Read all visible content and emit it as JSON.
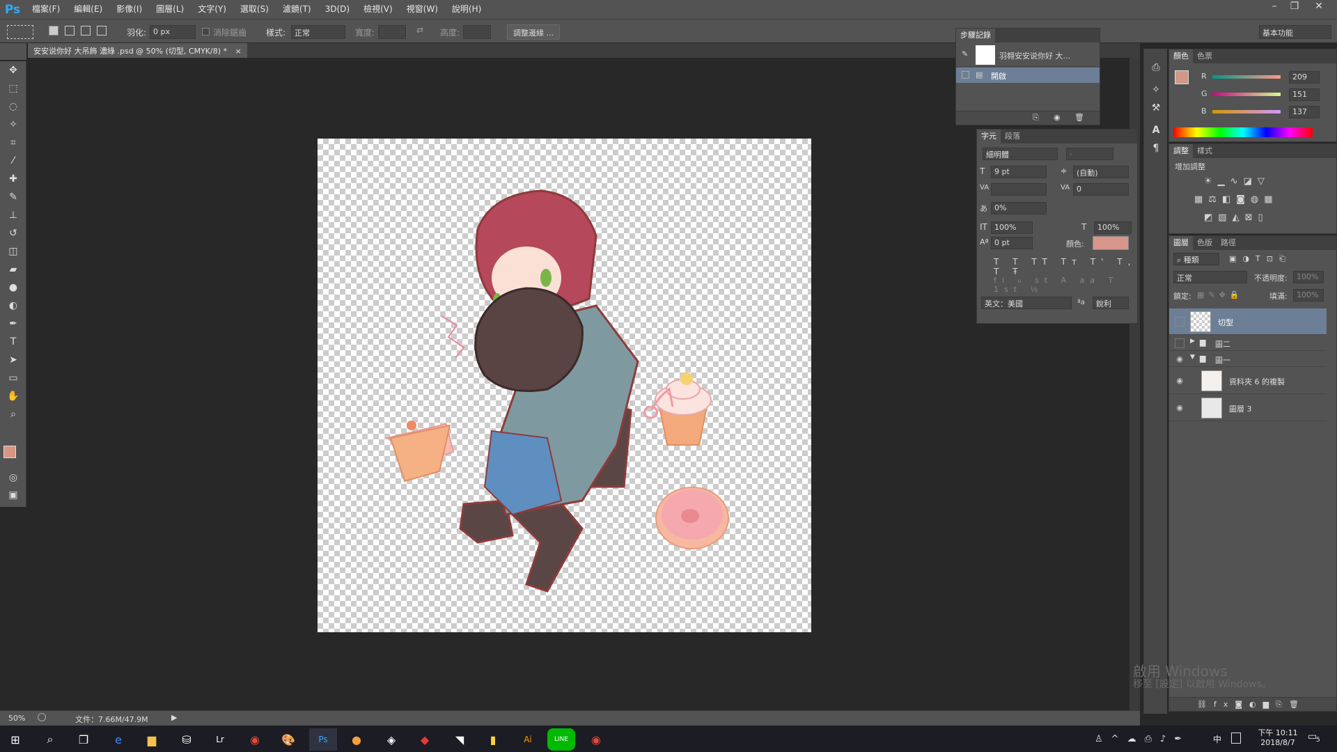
{
  "app": {
    "logo": "Ps"
  },
  "menu": [
    "檔案(F)",
    "編輯(E)",
    "影像(I)",
    "圖層(L)",
    "文字(Y)",
    "選取(S)",
    "濾鏡(T)",
    "3D(D)",
    "檢視(V)",
    "視窗(W)",
    "說明(H)"
  ],
  "window_controls": {
    "minimize": "–",
    "restore": "❐",
    "close": "✕"
  },
  "options": {
    "feather_label": "羽化:",
    "feather_value": "0 px",
    "antialias_label": "消除鋸齒",
    "style_label": "樣式:",
    "style_value": "正常",
    "width_label": "寬度:",
    "height_label": "高度:",
    "refine_edge": "調整邊緣 ...",
    "workspace": "基本功能"
  },
  "document": {
    "tab_title": "安安说你好 大吊飾 濃綠 .psd @ 50% (切型, CMYK/8) *",
    "close": "×"
  },
  "status": {
    "zoom": "50%",
    "doc_size": "文件：7.66M/47.9M"
  },
  "history_panel": {
    "title": "步驟記錄",
    "items": [
      {
        "label": "羽翱安安说你好 大..."
      },
      {
        "label": "開啟"
      }
    ]
  },
  "character_panel": {
    "tabs": [
      "字元",
      "段落"
    ],
    "font_family": "細明體",
    "font_style": "-",
    "font_size": "9 pt",
    "leading": "(自動)",
    "kerning": "",
    "tracking": "0",
    "tsume": "0%",
    "vscale": "100%",
    "hscale": "100%",
    "baseline": "0 pt",
    "color_label": "顏色:",
    "type_styles": [
      "T",
      "T",
      "TT",
      "Tт",
      "T'",
      "T,",
      "T",
      "Ŧ"
    ],
    "opentype": [
      "fi",
      "ℴ",
      "st",
      "A",
      "aa",
      "T",
      "1st",
      "½"
    ],
    "language": "英文：美國",
    "aa_label": "ªa",
    "antialias": "銳利",
    "color": "#d8968a"
  },
  "color_panel": {
    "tabs": [
      "顏色",
      "色票"
    ],
    "r_label": "R",
    "g_label": "G",
    "b_label": "B",
    "r": "209",
    "g": "151",
    "b": "137",
    "swatch": "#d19789"
  },
  "adjustments_panel": {
    "tabs": [
      "調整",
      "樣式"
    ],
    "title": "增加調整"
  },
  "layers_panel": {
    "tabs": [
      "圖層",
      "色版",
      "路徑"
    ],
    "filter": "種類",
    "blend_mode": "正常",
    "opacity_label": "不透明度:",
    "opacity": "100%",
    "lock_label": "鎖定:",
    "fill_label": "填滿:",
    "fill": "100%",
    "layers": [
      {
        "name": "切型",
        "visible": false,
        "selected": true
      },
      {
        "name": "圖二",
        "visible": false,
        "group": true
      },
      {
        "name": "圖一",
        "visible": true,
        "group": true,
        "open": true
      },
      {
        "name": "資料夾 6 的複製",
        "visible": true
      },
      {
        "name": "圖層 3",
        "visible": true
      }
    ]
  },
  "watermark": {
    "line1": "啟用 Windows",
    "line2": "移至 [設定] 以啟用 Windows。"
  },
  "taskbar": {
    "time": "下午 10:11",
    "date": "2018/8/7",
    "ime": "中",
    "notif_count": "5",
    "apps": [
      "start-icon",
      "search-icon",
      "task-view-icon",
      "edge-icon",
      "explorer-icon",
      "store-icon",
      "lightroom-icon",
      "chrome-icon",
      "paint-icon",
      "photoshop-icon",
      "app-icon",
      "app2-icon",
      "garena-icon",
      "notes-icon",
      "bulb-icon",
      "illustrator-icon",
      "line-icon",
      "chrome2-icon"
    ],
    "app_labels": {
      "lr": "Lr",
      "ps": "Ps",
      "ai": "Ai",
      "line": "LINE"
    }
  }
}
